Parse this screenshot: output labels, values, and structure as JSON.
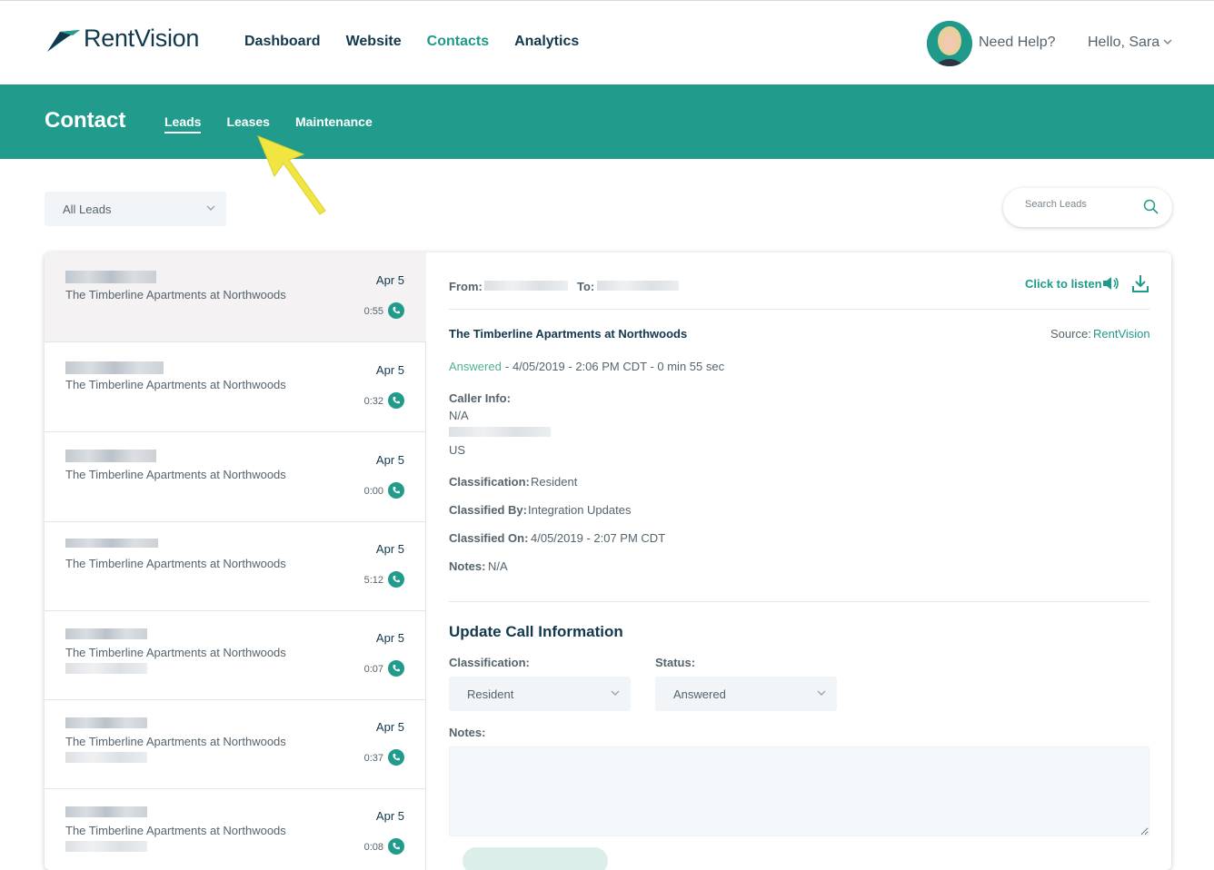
{
  "brand": {
    "name": "RentVision",
    "accent": "#219c8c"
  },
  "nav": {
    "items": [
      "Dashboard",
      "Website",
      "Contacts",
      "Analytics"
    ],
    "active": "Contacts"
  },
  "user": {
    "help": "Need Help?",
    "greeting": "Hello, Sara"
  },
  "subnav": {
    "title": "Contact",
    "tabs": [
      "Leads",
      "Leases",
      "Maintenance"
    ],
    "active": "Leads"
  },
  "filter": {
    "selected": "All Leads"
  },
  "search": {
    "placeholder": "Search Leads"
  },
  "leads": [
    {
      "property": "The Timberline Apartments at Northwoods",
      "date": "Apr 5",
      "duration": "0:55"
    },
    {
      "property": "The Timberline Apartments at Northwoods",
      "date": "Apr 5",
      "duration": "0:32"
    },
    {
      "property": "The Timberline Apartments at Northwoods",
      "date": "Apr 5",
      "duration": "0:00"
    },
    {
      "property": "The Timberline Apartments at Northwoods",
      "date": "Apr 5",
      "duration": "5:12"
    },
    {
      "property": "The Timberline Apartments at Northwoods",
      "date": "Apr 5",
      "duration": "0:07"
    },
    {
      "property": "The Timberline Apartments at Northwoods",
      "date": "Apr 5",
      "duration": "0:37"
    },
    {
      "property": "The Timberline Apartments at Northwoods",
      "date": "Apr 5",
      "duration": "0:08"
    }
  ],
  "detail": {
    "from_label": "From:",
    "to_label": "To:",
    "listen": "Click to listen",
    "property": "The Timberline Apartments at Northwoods",
    "source_label": "Source:",
    "source_value": "RentVision",
    "status": "Answered",
    "status_line": "- 4/05/2019 - 2:06 PM CDT - 0 min 55 sec",
    "caller_info_label": "Caller Info:",
    "caller_name": "N/A",
    "caller_country": "US",
    "classification_label": "Classification:",
    "classification_value": "Resident",
    "classified_by_label": "Classified By:",
    "classified_by_value": "Integration Updates",
    "classified_on_label": "Classified On:",
    "classified_on_value": "4/05/2019 - 2:07 PM CDT",
    "notes_label": "Notes:",
    "notes_value": "N/A"
  },
  "update": {
    "title": "Update Call Information",
    "classification_label": "Classification:",
    "classification_selected": "Resident",
    "status_label": "Status:",
    "status_selected": "Answered",
    "notes_label": "Notes:"
  }
}
